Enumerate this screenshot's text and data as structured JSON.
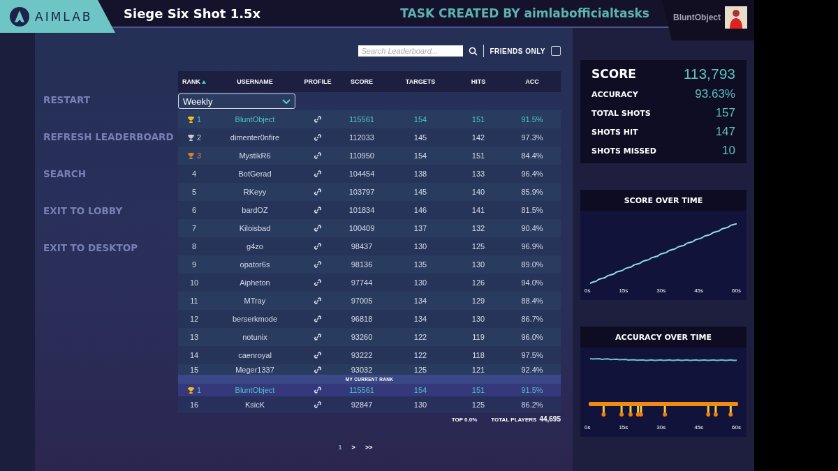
{
  "header": {
    "logo": "AIMLAB",
    "title": "Siege Six Shot 1.5x",
    "creator": "TASK CREATED BY aimlabofficialtasks",
    "user": "BluntObject"
  },
  "menu": [
    "RESTART",
    "REFRESH LEADERBOARD",
    "SEARCH",
    "EXIT TO LOBBY",
    "EXIT TO DESKTOP"
  ],
  "search": {
    "placeholder": "Search Leaderboard...",
    "friends_only_label": "FRIENDS ONLY",
    "friends_only_checked": false
  },
  "period": "Weekly",
  "table": {
    "columns": [
      {
        "label": "RANK",
        "sorted": true
      },
      {
        "label": "USERNAME",
        "sorted": false
      },
      {
        "label": "PROFILE",
        "sorted": false
      },
      {
        "label": "SCORE",
        "sorted": false
      },
      {
        "label": "TARGETS",
        "sorted": false
      },
      {
        "label": "HITS",
        "sorted": false
      },
      {
        "label": "ACC",
        "sorted": false
      }
    ],
    "rows": [
      {
        "rank": "1",
        "username": "BluntObject",
        "score": "115561",
        "targets": "154",
        "hits": "151",
        "acc": "91.5%",
        "trophy": {
          "color": "#f2c21b"
        },
        "self": true
      },
      {
        "rank": "2",
        "username": "dimenter0nfire",
        "score": "112033",
        "targets": "145",
        "hits": "142",
        "acc": "97.3%",
        "trophy": {
          "color": "#c8cbd2"
        },
        "self": false
      },
      {
        "rank": "3",
        "username": "MystikR6",
        "score": "110950",
        "targets": "154",
        "hits": "151",
        "acc": "84.4%",
        "trophy": {
          "color": "#d9803a"
        },
        "self": false
      },
      {
        "rank": "4",
        "username": "BotGerad",
        "score": "104454",
        "targets": "138",
        "hits": "133",
        "acc": "96.4%",
        "self": false
      },
      {
        "rank": "5",
        "username": "RKeyy",
        "score": "103797",
        "targets": "145",
        "hits": "140",
        "acc": "85.9%",
        "self": false
      },
      {
        "rank": "6",
        "username": "bardOZ",
        "score": "101834",
        "targets": "146",
        "hits": "141",
        "acc": "81.5%",
        "self": false
      },
      {
        "rank": "7",
        "username": "Kiloisbad",
        "score": "100409",
        "targets": "137",
        "hits": "132",
        "acc": "90.4%",
        "self": false
      },
      {
        "rank": "8",
        "username": "g4zo",
        "score": "98437",
        "targets": "130",
        "hits": "125",
        "acc": "96.9%",
        "self": false
      },
      {
        "rank": "9",
        "username": "opator6s",
        "score": "98136",
        "targets": "135",
        "hits": "130",
        "acc": "89.0%",
        "self": false
      },
      {
        "rank": "10",
        "username": "Aipheton",
        "score": "97744",
        "targets": "130",
        "hits": "126",
        "acc": "94.0%",
        "self": false
      },
      {
        "rank": "11",
        "username": "MTray",
        "score": "97005",
        "targets": "134",
        "hits": "129",
        "acc": "88.4%",
        "self": false
      },
      {
        "rank": "12",
        "username": "berserkmode",
        "score": "96818",
        "targets": "134",
        "hits": "130",
        "acc": "86.7%",
        "self": false
      },
      {
        "rank": "13",
        "username": "notunix",
        "score": "93260",
        "targets": "122",
        "hits": "119",
        "acc": "96.0%",
        "self": false
      },
      {
        "rank": "14",
        "username": "caenroyal",
        "score": "93222",
        "targets": "122",
        "hits": "118",
        "acc": "97.5%",
        "self": false
      },
      {
        "rank": "15",
        "username": "Meger1337",
        "score": "93032",
        "targets": "125",
        "hits": "121",
        "acc": "92.4%",
        "self": false
      }
    ],
    "my_rank_label": "MY CURRENT RANK",
    "my_row": {
      "rank": "1",
      "username": "BluntObject",
      "score": "115561",
      "targets": "154",
      "hits": "151",
      "acc": "91.5%",
      "trophy": {
        "color": "#f2c21b"
      },
      "self": true
    },
    "after_rows": [
      {
        "rank": "16",
        "username": "KsicK",
        "score": "92847",
        "targets": "130",
        "hits": "125",
        "acc": "86.2%",
        "self": false
      }
    ]
  },
  "footer": {
    "top": "TOP 0.0%",
    "total_label": "TOTAL PLAYERS",
    "total": "44,695"
  },
  "pagination": [
    {
      "label": "1",
      "selected": true
    },
    {
      "label": ">",
      "selected": false
    },
    {
      "label": ">>",
      "selected": false
    }
  ],
  "stats": [
    {
      "label": "SCORE",
      "value": "113,793",
      "kind": "main"
    },
    {
      "label": "ACCURACY",
      "value": "93.63%",
      "kind": "minor"
    },
    {
      "label": "TOTAL SHOTS",
      "value": "157",
      "kind": "minor"
    },
    {
      "label": "SHOTS HIT",
      "value": "147",
      "kind": "minor"
    },
    {
      "label": "SHOTS MISSED",
      "value": "10",
      "kind": "minor"
    }
  ],
  "charts": [
    {
      "title": "SCORE OVER TIME",
      "kind": "score",
      "xticks": [
        "0s",
        "15s",
        "30s",
        "45s",
        "60s"
      ]
    },
    {
      "title": "ACCURACY OVER TIME",
      "kind": "accuracy",
      "xticks": [
        "0s",
        "15s",
        "30s",
        "45s",
        "60s"
      ]
    }
  ]
}
